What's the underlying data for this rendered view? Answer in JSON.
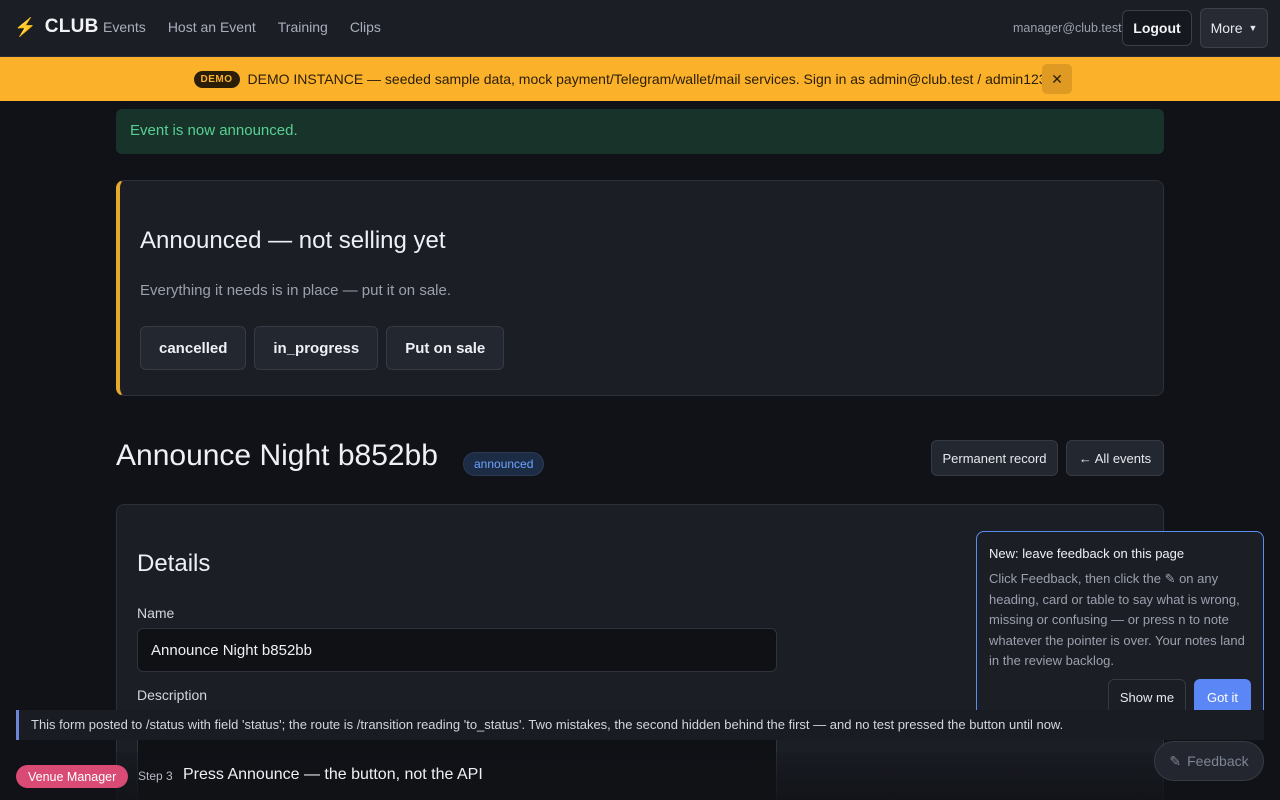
{
  "nav": {
    "brand": "CLUB",
    "brand_icon": "lightning-bolt-icon",
    "links": [
      "Events",
      "Host an Event",
      "Training",
      "Clips"
    ],
    "user_email": "manager@club.test",
    "logout_label": "Logout",
    "more_label": "More"
  },
  "demo_banner": {
    "badge": "DEMO",
    "text": "DEMO INSTANCE — seeded sample data, mock payment/Telegram/wallet/mail services. Sign in as admin@club.test / admin123.",
    "close_glyph": "✕"
  },
  "flash": {
    "message": "Event is now announced."
  },
  "status_card": {
    "title": "Announced — not selling yet",
    "subtitle": "Everything it needs is in place — put it on sale.",
    "actions": [
      "cancelled",
      "in_progress",
      "Put on sale"
    ]
  },
  "event": {
    "title": "Announce Night b852bb",
    "status_badge": "announced",
    "permanent_record_label": "Permanent record",
    "all_events_label": "← All events"
  },
  "details": {
    "heading": "Details",
    "name_label": "Name",
    "name_value": "Announce Night b852bb",
    "description_label": "Description"
  },
  "feedback_popover": {
    "title": "New: leave feedback on this page",
    "body": "Click Feedback, then click the ✎ on any heading, card or table to say what is wrong, missing or confusing — or press n to note whatever the pointer is over. Your notes land in the review backlog.",
    "show_me_label": "Show me",
    "got_it_label": "Got it"
  },
  "note": {
    "text": "This form posted to /status with field 'status'; the route is /transition reading 'to_status'. Two mistakes, the second hidden behind the first — and no test pressed the button until now."
  },
  "feedback_button": {
    "label": "Feedback",
    "icon": "pencil-icon"
  },
  "step_bar": {
    "role": "Venue Manager",
    "step_number": "Step 3",
    "step_text": "Press Announce — the button, not the API"
  },
  "colors": {
    "banner": "#fbb12a",
    "accent_blue": "#5b86f5",
    "success_text": "#57d193",
    "status_border": "#e5a92b",
    "role_pill": "#d94a74"
  }
}
